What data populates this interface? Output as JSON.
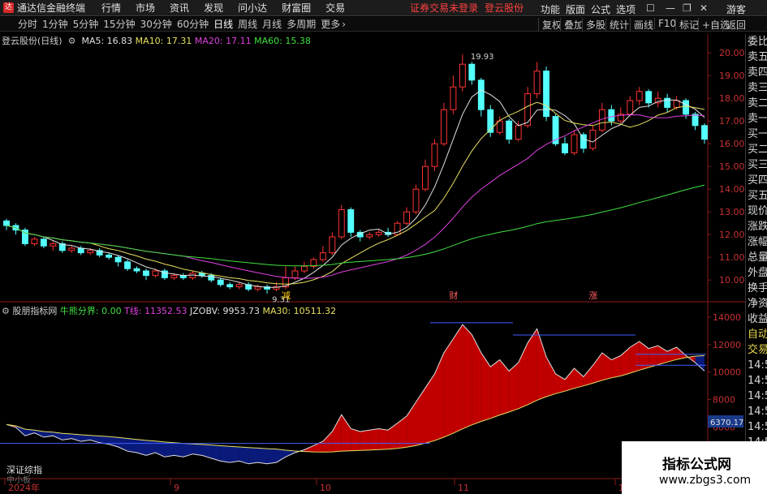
{
  "menubar": {
    "app_title": "通达信金融终端",
    "items": [
      "行情",
      "市场",
      "资讯",
      "发现",
      "问小达",
      "财富圈",
      "交易"
    ],
    "warning": "证券交易未登录",
    "stock_name": "登云股份",
    "right_items": [
      "功能",
      "版面",
      "公式",
      "选项"
    ],
    "user": "游客"
  },
  "periodbar": {
    "periods": [
      "分时",
      "1分钟",
      "5分钟",
      "15分钟",
      "30分钟",
      "60分钟",
      "日线",
      "周线",
      "月线",
      "多周期",
      "更多"
    ],
    "active": "日线",
    "tools": [
      "复权",
      "叠加",
      "多股",
      "统计",
      "画线",
      "F10",
      "标记",
      "+自选",
      "返回"
    ]
  },
  "main_chart": {
    "title": "登云股份(日线)",
    "ma_labels": [
      {
        "text": "MA5: 16.83",
        "color": "#e0e0e0"
      },
      {
        "text": "MA10: 17.31",
        "color": "#e8e060"
      },
      {
        "text": "MA20: 17.11",
        "color": "#e040e0"
      },
      {
        "text": "MA60: 15.38",
        "color": "#40e040"
      }
    ],
    "y_ticks": [
      "20.00",
      "19.00",
      "18.00",
      "17.00",
      "16.00",
      "15.00",
      "14.00",
      "13.00",
      "12.00",
      "11.00",
      "10.00"
    ],
    "high_label": "19.93",
    "low_label": "9.31",
    "markers": [
      "减",
      "财",
      "涨"
    ]
  },
  "sub_chart": {
    "title": "股朋指标网",
    "labels": [
      {
        "text": "牛熊分界: 0.00",
        "color": "#40e040"
      },
      {
        "text": "T线: 11352.53",
        "color": "#e040e0"
      },
      {
        "text": "JZOBV: 9953.73",
        "color": "#e0e0e0"
      },
      {
        "text": "MA30: 10511.32",
        "color": "#e8e060"
      }
    ],
    "y_ticks": [
      "14000",
      "12000",
      "10000",
      "8000",
      "6000",
      "4000"
    ],
    "current_value": "6370.17",
    "bottom_label": "深证综指",
    "bottom_label2": "中小板"
  },
  "x_axis": [
    "2024年",
    "9",
    "10",
    "11",
    "12"
  ],
  "right_panel": [
    "委比",
    "卖五",
    "卖四",
    "卖三",
    "卖二",
    "卖一",
    "买一",
    "买二",
    "买三",
    "买四",
    "买五",
    "现价",
    "涨跌",
    "涨幅",
    "总量",
    "外盘",
    "换手",
    "净资",
    "收益",
    "自动",
    "交易",
    "14:55",
    "14:56",
    "14:56",
    "14:56",
    "14:56",
    "14:56",
    "14:56"
  ],
  "watermark": {
    "line1": "指标公式网",
    "line2": "www.zbgs3.com"
  },
  "chart_data": {
    "type": "candlestick",
    "title": "登云股份(日线)",
    "ylim": [
      9.31,
      19.93
    ],
    "x_ticks": [
      "2024年",
      "9",
      "10",
      "11",
      "12"
    ],
    "series": [
      {
        "name": "MA5",
        "last": 16.83
      },
      {
        "name": "MA10",
        "last": 17.31
      },
      {
        "name": "MA20",
        "last": 17.11
      },
      {
        "name": "MA60",
        "last": 15.38
      }
    ],
    "candles": [
      [
        12.6,
        12.4,
        12.7,
        12.2
      ],
      [
        12.4,
        12.2,
        12.5,
        12.0
      ],
      [
        12.2,
        11.6,
        12.3,
        11.5
      ],
      [
        11.6,
        11.8,
        11.9,
        11.5
      ],
      [
        11.8,
        11.5,
        11.9,
        11.4
      ],
      [
        11.5,
        11.6,
        11.7,
        11.3
      ],
      [
        11.6,
        11.3,
        11.7,
        11.2
      ],
      [
        11.3,
        11.4,
        11.5,
        11.2
      ],
      [
        11.4,
        11.2,
        11.5,
        11.1
      ],
      [
        11.2,
        11.3,
        11.4,
        11.1
      ],
      [
        11.3,
        11.1,
        11.4,
        11.0
      ],
      [
        11.1,
        11.0,
        11.2,
        10.9
      ],
      [
        11.0,
        10.8,
        11.1,
        10.6
      ],
      [
        10.8,
        10.5,
        10.9,
        10.4
      ],
      [
        10.5,
        10.4,
        10.6,
        10.3
      ],
      [
        10.4,
        10.2,
        10.5,
        10.0
      ],
      [
        10.2,
        10.4,
        10.5,
        10.1
      ],
      [
        10.4,
        10.1,
        10.5,
        10.0
      ],
      [
        10.1,
        10.2,
        10.3,
        10.0
      ],
      [
        10.2,
        10.1,
        10.3,
        10.0
      ],
      [
        10.1,
        10.3,
        10.4,
        10.0
      ],
      [
        10.3,
        10.2,
        10.4,
        10.1
      ],
      [
        10.2,
        10.0,
        10.3,
        9.9
      ],
      [
        10.0,
        9.8,
        10.1,
        9.7
      ],
      [
        9.8,
        9.7,
        9.9,
        9.6
      ],
      [
        9.7,
        9.8,
        9.9,
        9.6
      ],
      [
        9.8,
        9.6,
        9.9,
        9.5
      ],
      [
        9.6,
        9.7,
        9.8,
        9.5
      ],
      [
        9.7,
        9.6,
        9.8,
        9.4
      ],
      [
        9.6,
        9.7,
        9.9,
        9.5
      ],
      [
        9.7,
        10.1,
        10.6,
        9.6
      ],
      [
        10.1,
        10.4,
        10.6,
        10.0
      ],
      [
        10.4,
        10.6,
        10.8,
        10.3
      ],
      [
        10.6,
        10.9,
        11.0,
        10.5
      ],
      [
        10.9,
        11.2,
        11.5,
        10.8
      ],
      [
        11.2,
        11.9,
        12.1,
        11.1
      ],
      [
        11.9,
        13.1,
        13.3,
        11.8
      ],
      [
        13.1,
        12.1,
        13.2,
        11.9
      ],
      [
        12.1,
        11.9,
        12.2,
        11.7
      ],
      [
        11.9,
        12.0,
        12.1,
        11.8
      ],
      [
        12.0,
        12.1,
        12.2,
        11.9
      ],
      [
        12.1,
        12.0,
        12.3,
        11.9
      ],
      [
        12.0,
        12.5,
        12.6,
        12.0
      ],
      [
        12.5,
        13.0,
        13.2,
        12.4
      ],
      [
        13.0,
        14.0,
        14.2,
        12.9
      ],
      [
        14.0,
        15.0,
        15.3,
        13.9
      ],
      [
        15.0,
        16.0,
        16.2,
        14.8
      ],
      [
        16.0,
        17.5,
        17.8,
        15.9
      ],
      [
        17.5,
        18.5,
        19.0,
        17.3
      ],
      [
        18.5,
        19.5,
        19.93,
        18.3
      ],
      [
        19.5,
        18.8,
        19.6,
        18.6
      ],
      [
        18.8,
        17.5,
        18.9,
        17.2
      ],
      [
        17.5,
        16.5,
        17.7,
        16.3
      ],
      [
        16.5,
        17.0,
        17.2,
        16.4
      ],
      [
        17.0,
        16.2,
        17.1,
        16.0
      ],
      [
        16.2,
        16.8,
        17.0,
        16.1
      ],
      [
        16.8,
        18.2,
        18.5,
        16.7
      ],
      [
        18.2,
        19.2,
        19.6,
        18.0
      ],
      [
        19.2,
        17.2,
        19.4,
        17.0
      ],
      [
        17.2,
        16.0,
        17.3,
        15.9
      ],
      [
        16.0,
        15.6,
        16.3,
        15.5
      ],
      [
        15.6,
        16.4,
        16.6,
        15.5
      ],
      [
        16.4,
        15.8,
        16.5,
        15.6
      ],
      [
        15.8,
        16.6,
        16.8,
        15.7
      ],
      [
        16.6,
        17.5,
        17.8,
        16.5
      ],
      [
        17.5,
        17.0,
        17.7,
        16.8
      ],
      [
        17.0,
        17.3,
        17.6,
        16.9
      ],
      [
        17.3,
        17.9,
        18.1,
        17.2
      ],
      [
        17.9,
        18.3,
        18.5,
        17.7
      ],
      [
        18.3,
        17.8,
        18.4,
        17.6
      ],
      [
        17.8,
        18.0,
        18.3,
        17.6
      ],
      [
        18.0,
        17.6,
        18.2,
        17.4
      ],
      [
        17.6,
        17.9,
        18.1,
        17.5
      ],
      [
        17.9,
        17.3,
        18.0,
        17.1
      ],
      [
        17.3,
        16.8,
        17.4,
        16.6
      ],
      [
        16.8,
        16.2,
        16.9,
        16.0
      ]
    ]
  }
}
